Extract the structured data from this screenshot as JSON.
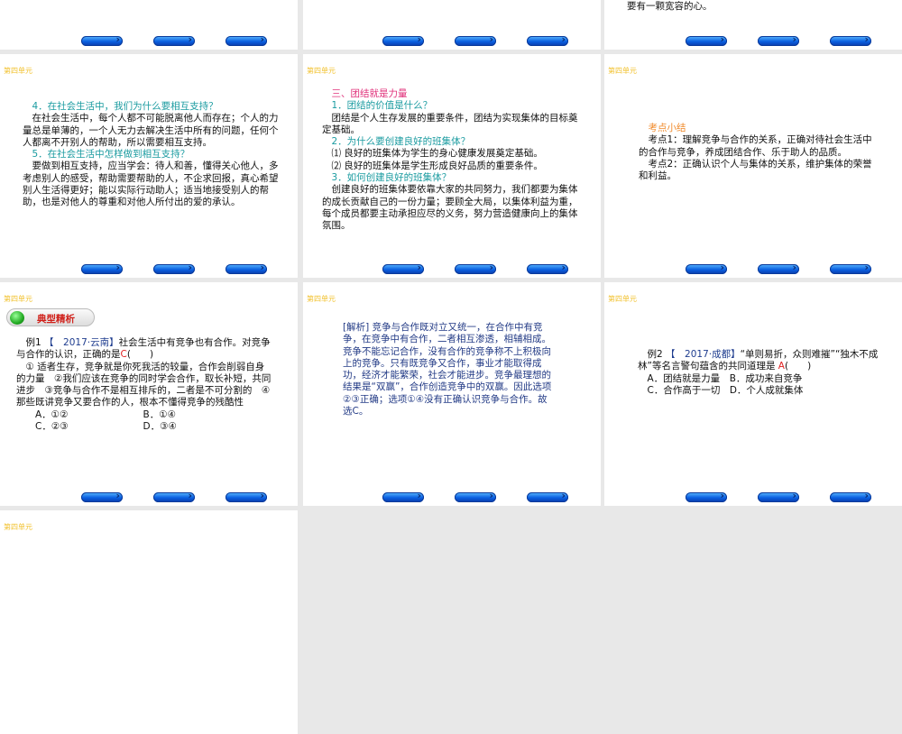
{
  "unit_label": "第四单元",
  "slides": {
    "top_right": {
      "line": "要有一颗宽容的心。"
    },
    "support": {
      "q4": "4．在社会生活中，我们为什么要相互支持？",
      "a4": "在社会生活中，每个人都不可能脱离他人而存在；个人的力量总是单薄的，一个人无力去解决生活中所有的问题，任何个人都离不开别人的帮助，所以需要相互支持。",
      "q5": "5．在社会生活中怎样做到相互支持？",
      "a5": "要做到相互支持，应当学会：待人和善，懂得关心他人，多考虑别人的感受，帮助需要帮助的人，不企求回报，真心希望别人生活得更好；能以实际行动助人；适当地接受别人的帮助，也是对他人的尊重和对他人所付出的爱的承认。"
    },
    "unity": {
      "heading": "三、团结就是力量",
      "q1": "1．团结的价值是什么？",
      "a1": "团结是个人生存发展的重要条件，团结为实现集体的目标奠定基础。",
      "q2": "2．为什么要创建良好的班集体？",
      "a2a": "⑴ 良好的班集体为学生的身心健康发展奠定基础。",
      "a2b": "⑵ 良好的班集体是学生形成良好品质的重要条件。",
      "q3": "3．如何创建良好的班集体？",
      "a3": "创建良好的班集体要依靠大家的共同努力，我们都要为集体的成长贡献自己的一份力量；要顾全大局，以集体利益为重，每个成员都要主动承担应尽的义务，努力营造健康向上的集体氛围。"
    },
    "summary": {
      "heading": "考点小结",
      "p1": "考点1：理解竞争与合作的关系，正确对待社会生活中的合作与竞争，养成团结合作、乐于助人的品质。",
      "p2": "考点2：正确认识个人与集体的关系，维护集体的荣誉和利益。"
    },
    "example1": {
      "badge": "典型精析",
      "label": "例1",
      "source": "【　2017·云南】",
      "stem": "社会生活中有竞争也有合作。对竞争与合作的认识，正确的是",
      "answer": "C",
      "paren": "(　　)",
      "statements": "① 适者生存，竞争就是你死我活的较量，合作会削弱自身的力量　②我们应该在竞争的同时学会合作，取长补短，共同进步　③竞争与合作不是相互排斥的，二者是不可分割的　④那些既讲竞争又要合作的人，根本不懂得竞争的残酷性",
      "options": [
        "A．①②",
        "B．①④",
        "C．②③",
        "D．③④"
      ]
    },
    "analysis": {
      "tag": "[解析]",
      "text": "竞争与合作既对立又统一，在合作中有竞争，在竞争中有合作，二者相互渗透，相辅相成。竞争不能忘记合作，没有合作的竞争称不上积极向上的竞争。只有既竞争又合作，事业才能取得成功，经济才能繁荣，社会才能进步。竞争最理想的结果是“双赢”，合作创造竞争中的双赢。因此选项②③正确；选项①④没有正确认识竞争与合作。故选C。"
    },
    "example2": {
      "label": "例2",
      "source": "【　2017·成都】",
      "stem": "“单则易折，众则难摧”“独木不成林”等名言警句蕴含的共同道理是",
      "answer": "A",
      "paren": "(　　)",
      "options": [
        "A．团结就是力量",
        "B．成功来自竞争",
        "C．合作高于一切",
        "D．个人成就集体"
      ]
    }
  }
}
